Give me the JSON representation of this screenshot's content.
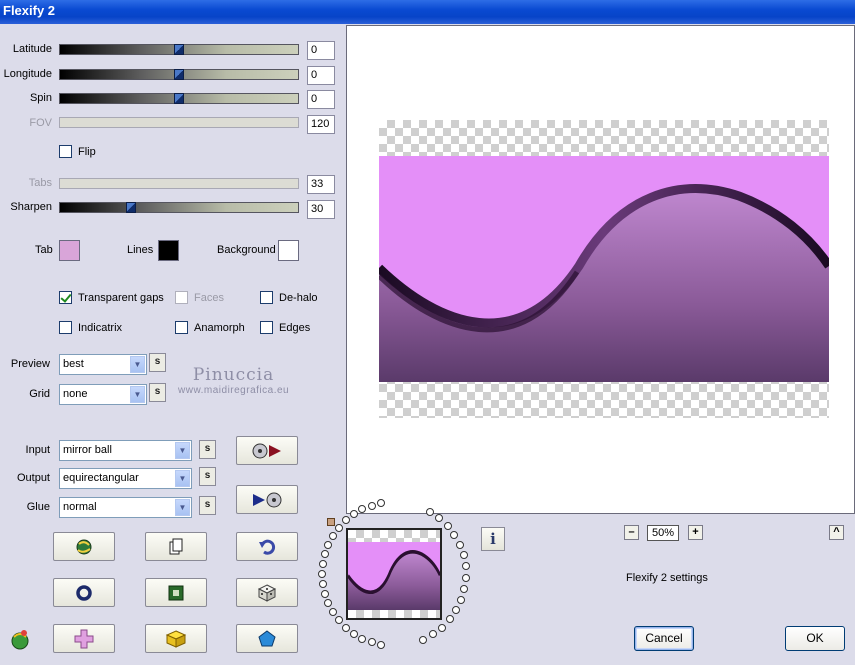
{
  "window": {
    "title": "Flexify 2"
  },
  "sliders": [
    {
      "label": "Latitude",
      "value": "0",
      "enabled": true,
      "fraction": 0.5
    },
    {
      "label": "Longitude",
      "value": "0",
      "enabled": true,
      "fraction": 0.5
    },
    {
      "label": "Spin",
      "value": "0",
      "enabled": true,
      "fraction": 0.5
    },
    {
      "label": "FOV",
      "value": "120",
      "enabled": false
    },
    {
      "label": "Tabs",
      "value": "33",
      "enabled": false
    },
    {
      "label": "Sharpen",
      "value": "30",
      "enabled": true,
      "fraction": 0.3
    }
  ],
  "flip": {
    "label": "Flip",
    "checked": false
  },
  "colors": {
    "tab": {
      "label": "Tab",
      "color": "#d9a5d9"
    },
    "lines": {
      "label": "Lines",
      "color": "#000000"
    },
    "background": {
      "label": "Background",
      "color": "#ffffff"
    }
  },
  "options": {
    "transparent_gaps": {
      "label": "Transparent gaps",
      "checked": true
    },
    "faces": {
      "label": "Faces",
      "checked": false,
      "enabled": false
    },
    "de_halo": {
      "label": "De-halo",
      "checked": false
    },
    "indicatrix": {
      "label": "Indicatrix",
      "checked": false
    },
    "anamorph": {
      "label": "Anamorph",
      "checked": false
    },
    "edges": {
      "label": "Edges",
      "checked": false
    }
  },
  "preview": {
    "label": "Preview",
    "value": "best",
    "s": "s"
  },
  "grid": {
    "label": "Grid",
    "value": "none",
    "s": "s"
  },
  "input": {
    "label": "Input",
    "value": "mirror ball",
    "s": "s"
  },
  "output": {
    "label": "Output",
    "value": "equirectangular",
    "s": "s"
  },
  "glue": {
    "label": "Glue",
    "value": "normal",
    "s": "s"
  },
  "watermark": {
    "line1": "Pinuccia",
    "line2": "www.maidiregrafica.eu"
  },
  "zoom": {
    "value": "50%",
    "minus": "–",
    "plus": "+"
  },
  "info": {
    "label": "i"
  },
  "collapse": {
    "label": "^"
  },
  "status": {
    "text": "Flexify 2 settings"
  },
  "dialog": {
    "cancel": "Cancel",
    "ok": "OK"
  },
  "accent": {
    "preview_pink": "#e48ff8",
    "wave_dark": "#2a1030"
  }
}
